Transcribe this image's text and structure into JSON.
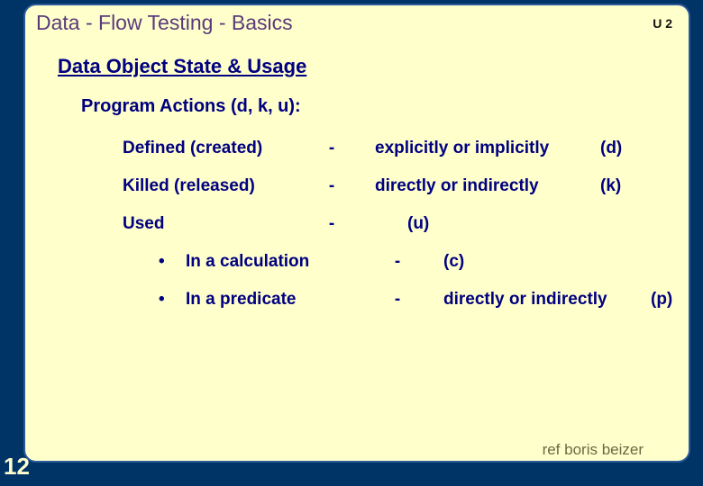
{
  "header": {
    "title": "Data - Flow Testing   -  Basics",
    "unit": "U 2"
  },
  "subTitle": "Data Object State  & Usage",
  "sectionHeading": "Program Actions   (d, k, u):",
  "actions": [
    {
      "label": "Defined (created)",
      "sep": "-",
      "desc": "explicitly  or implicitly",
      "tag": "(d)"
    },
    {
      "label": "Killed (released)",
      "sep": "-",
      "desc": "directly or indirectly",
      "tag": "(k)"
    },
    {
      "label": "Used",
      "sep": "-",
      "desc": "(u)",
      "tag": ""
    }
  ],
  "subActions": [
    {
      "bullet": "•",
      "label": "In a  calculation",
      "sep": "-",
      "detail": "(c)",
      "tag": ""
    },
    {
      "bullet": "•",
      "label": "In a predicate",
      "sep": "-",
      "detail": "directly or indirectly",
      "tag": "(p)"
    }
  ],
  "footer": {
    "pageNum": "12",
    "credit": "ref boris beizer"
  }
}
